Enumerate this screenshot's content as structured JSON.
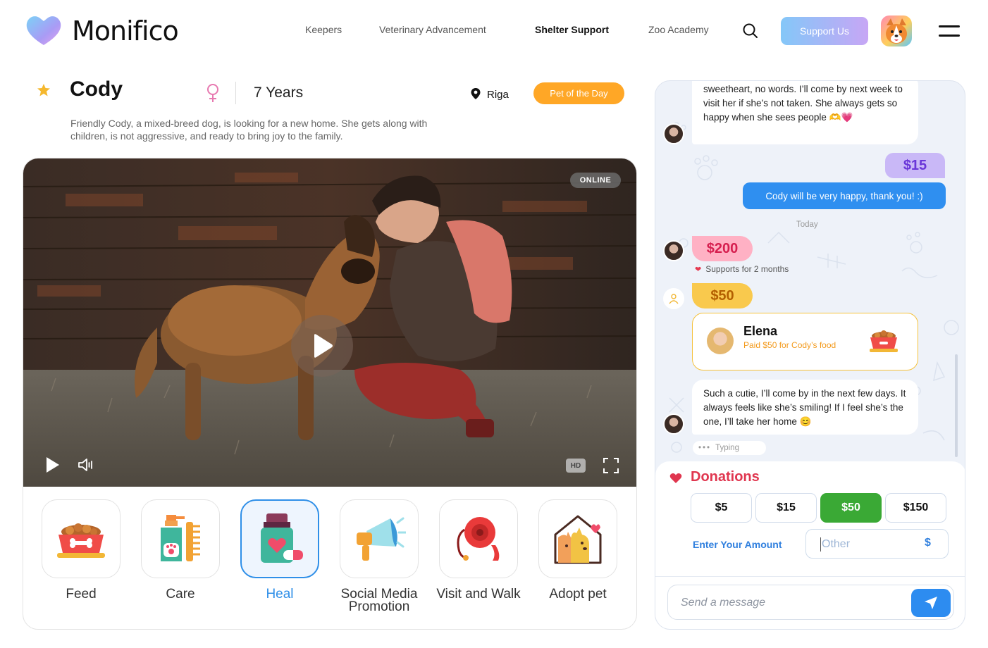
{
  "header": {
    "logo_text": "Monifico",
    "nav": [
      "Keepers",
      "Veterinary Advancement",
      "Shelter Support",
      "Zoo Academy"
    ],
    "active_nav": "Shelter Support",
    "support_label": "Support Us"
  },
  "pet": {
    "name": "Cody",
    "age": "7 Years",
    "city": "Riga",
    "badge": "Pet of the Day",
    "description": "Friendly Cody, a mixed-breed dog, is looking for a new home. She gets along with children, is not aggressive, and ready to bring joy to the family."
  },
  "video": {
    "status": "ONLINE",
    "quality": "HD"
  },
  "actions": [
    {
      "label": "Feed",
      "icon": "food-bowl-icon"
    },
    {
      "label": "Care",
      "icon": "grooming-kit-icon"
    },
    {
      "label": "Heal",
      "icon": "medicine-icon",
      "active": true
    },
    {
      "label": "Social Media Promotion",
      "icon": "megaphone-icon"
    },
    {
      "label": "Visit and Walk",
      "icon": "leash-icon"
    },
    {
      "label": "Adopt pet",
      "icon": "pet-house-icon"
    }
  ],
  "chat": {
    "msg1": "sweetheart, no words. I’ll come by next week to visit her if she’s not taken. She always gets so happy when she sees people 🫶💗",
    "amount1": "$15",
    "reply1": "Cody will be very happy, thank you! :)",
    "day_label": "Today",
    "amount2": "$200",
    "supports_text": "Supports for 2 months",
    "amount3": "$50",
    "gift": {
      "name": "Elena",
      "text": "Paid $50 for Cody’s food"
    },
    "msg2": "Such a cutie, I’ll come by in the next few days. It always feels like she’s smiling! If I feel she’s the one, I’ll take her home 😊",
    "typing": "Typing"
  },
  "donations": {
    "title": "Donations",
    "amounts": [
      "$5",
      "$15",
      "$50",
      "$150"
    ],
    "selected": "$50",
    "enter_label": "Enter Your Amount",
    "other_placeholder": "Other",
    "currency": "$",
    "message_placeholder": "Send a message"
  },
  "colors": {
    "accent_blue": "#2f8ff0",
    "badge_orange": "#ffa726",
    "donate_green": "#3aa935",
    "donations_red": "#e0364f"
  }
}
